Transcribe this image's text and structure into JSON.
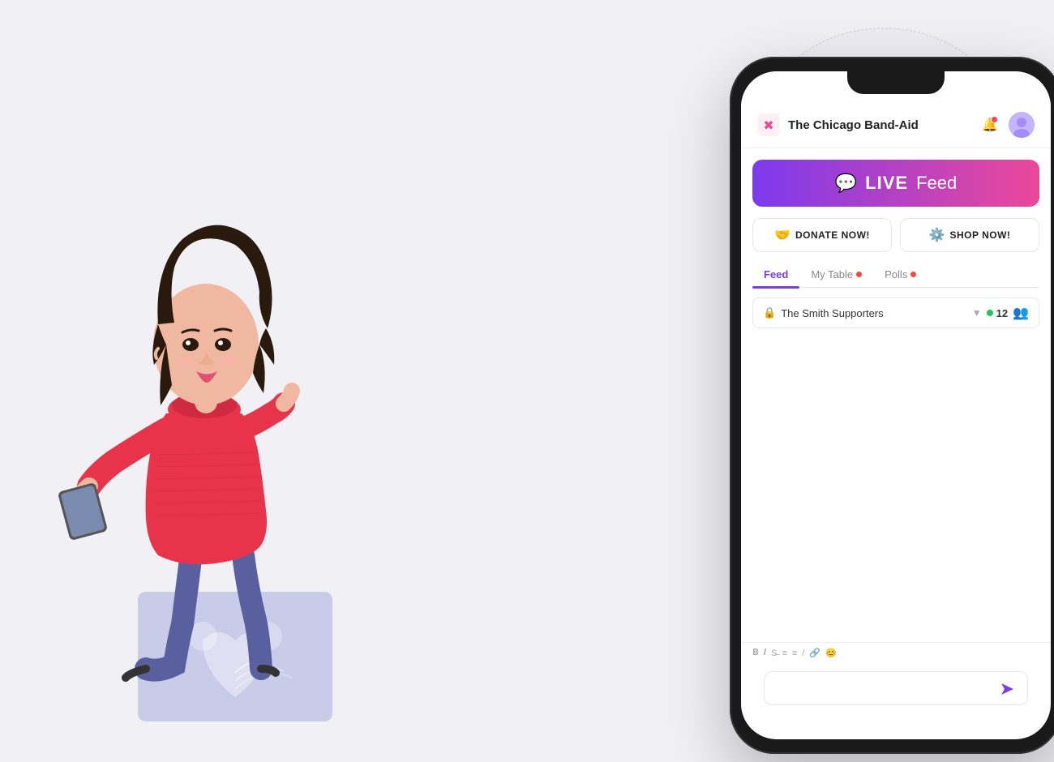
{
  "app": {
    "title": "The Chicago Band-Aid",
    "logo_emoji": "✖",
    "logo_color": "#ec4899"
  },
  "live_feed_banner": {
    "icon": "💬",
    "live_label": "LIVE",
    "feed_label": "Feed"
  },
  "action_buttons": {
    "donate": {
      "icon": "🤝",
      "label": "DONATE NOW!"
    },
    "shop": {
      "icon": "⚙️",
      "label": "SHOP NOW!"
    }
  },
  "tabs": [
    {
      "label": "Feed",
      "active": true,
      "has_dot": false
    },
    {
      "label": "My Table",
      "active": false,
      "has_dot": true
    },
    {
      "label": "Polls",
      "active": false,
      "has_dot": true
    }
  ],
  "table_selector": {
    "name": "The Smith Supporters",
    "count": 12,
    "count_color": "#22c55e"
  },
  "toolbar_icons": [
    "B",
    "I",
    "S",
    "≡",
    "≡",
    "/",
    "🔗",
    "😊"
  ],
  "chat_placeholder": "",
  "send_icon": "➤"
}
